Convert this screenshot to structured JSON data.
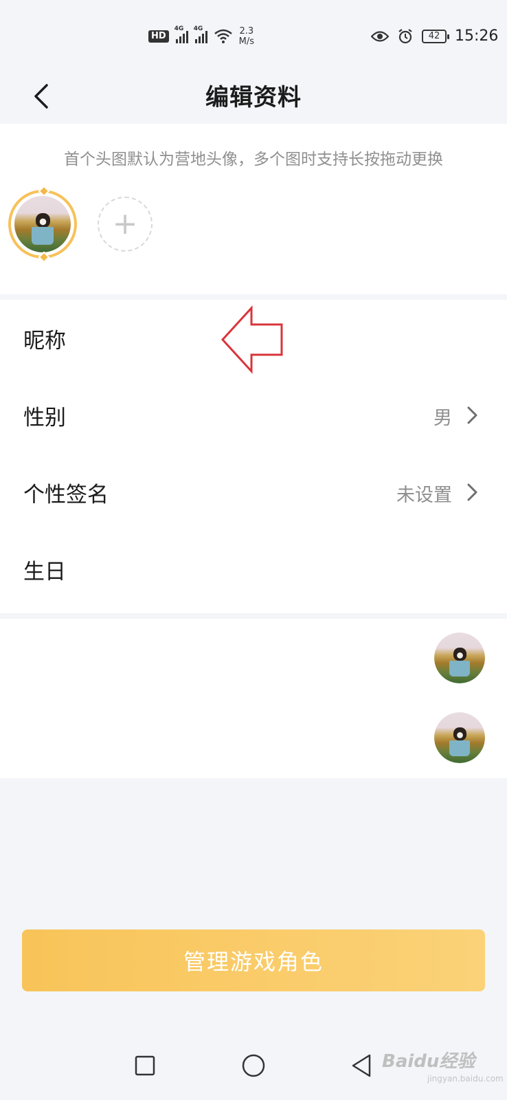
{
  "status_bar": {
    "hd": "HD",
    "net1": "4G",
    "net2": "4G",
    "speed_value": "2.3",
    "speed_unit": "M/s",
    "battery": "42",
    "time": "15:26",
    "icons": [
      "eye-icon",
      "alarm-icon",
      "battery-icon",
      "wifi-icon",
      "signal-icon"
    ]
  },
  "header": {
    "title": "编辑资料",
    "back_icon": "chevron-left-icon"
  },
  "avatar_section": {
    "hint": "首个头图默认为营地头像，多个图时支持长按拖动更换",
    "add_symbol": "+"
  },
  "form": {
    "rows": [
      {
        "label": "昵称",
        "value": ""
      },
      {
        "label": "性别",
        "value": "男"
      },
      {
        "label": "个性签名",
        "value": "未设置"
      },
      {
        "label": "生日",
        "value": ""
      }
    ]
  },
  "action_button": {
    "label": "管理游戏角色"
  },
  "nav_bar": {
    "buttons": [
      "recents-square-icon",
      "home-circle-icon",
      "back-triangle-icon"
    ]
  },
  "watermark": {
    "text": "Baidu经验",
    "sub": "jingyan.baidu.com"
  },
  "colors": {
    "accent": "#f8c459",
    "avatar_ring": "#f7c15a",
    "arrow": "#d9343a",
    "background": "#f3f5f9"
  }
}
